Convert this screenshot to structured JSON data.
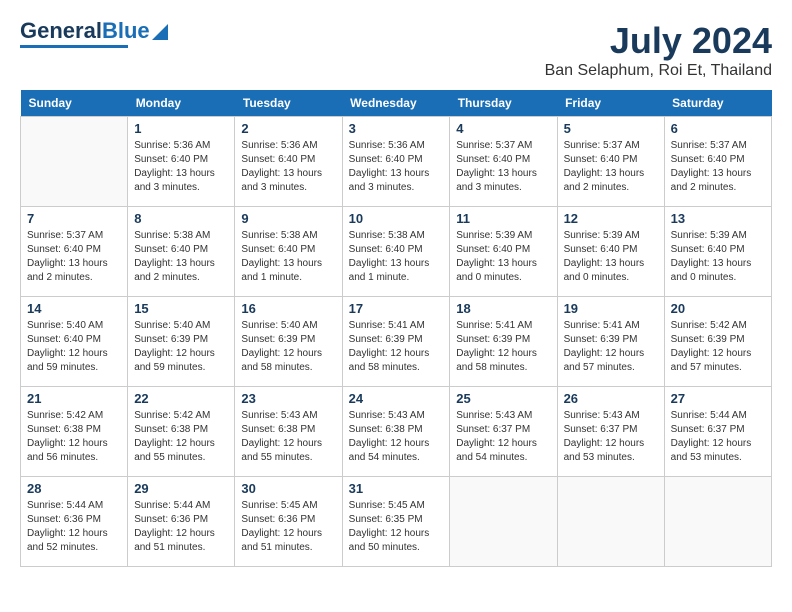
{
  "app": {
    "logo_general": "General",
    "logo_blue": "Blue",
    "month": "July 2024",
    "location": "Ban Selaphum, Roi Et, Thailand"
  },
  "calendar": {
    "headers": [
      "Sunday",
      "Monday",
      "Tuesday",
      "Wednesday",
      "Thursday",
      "Friday",
      "Saturday"
    ],
    "weeks": [
      [
        {
          "day": "",
          "info": ""
        },
        {
          "day": "1",
          "info": "Sunrise: 5:36 AM\nSunset: 6:40 PM\nDaylight: 13 hours\nand 3 minutes."
        },
        {
          "day": "2",
          "info": "Sunrise: 5:36 AM\nSunset: 6:40 PM\nDaylight: 13 hours\nand 3 minutes."
        },
        {
          "day": "3",
          "info": "Sunrise: 5:36 AM\nSunset: 6:40 PM\nDaylight: 13 hours\nand 3 minutes."
        },
        {
          "day": "4",
          "info": "Sunrise: 5:37 AM\nSunset: 6:40 PM\nDaylight: 13 hours\nand 3 minutes."
        },
        {
          "day": "5",
          "info": "Sunrise: 5:37 AM\nSunset: 6:40 PM\nDaylight: 13 hours\nand 2 minutes."
        },
        {
          "day": "6",
          "info": "Sunrise: 5:37 AM\nSunset: 6:40 PM\nDaylight: 13 hours\nand 2 minutes."
        }
      ],
      [
        {
          "day": "7",
          "info": "Sunrise: 5:37 AM\nSunset: 6:40 PM\nDaylight: 13 hours\nand 2 minutes."
        },
        {
          "day": "8",
          "info": "Sunrise: 5:38 AM\nSunset: 6:40 PM\nDaylight: 13 hours\nand 2 minutes."
        },
        {
          "day": "9",
          "info": "Sunrise: 5:38 AM\nSunset: 6:40 PM\nDaylight: 13 hours\nand 1 minute."
        },
        {
          "day": "10",
          "info": "Sunrise: 5:38 AM\nSunset: 6:40 PM\nDaylight: 13 hours\nand 1 minute."
        },
        {
          "day": "11",
          "info": "Sunrise: 5:39 AM\nSunset: 6:40 PM\nDaylight: 13 hours\nand 0 minutes."
        },
        {
          "day": "12",
          "info": "Sunrise: 5:39 AM\nSunset: 6:40 PM\nDaylight: 13 hours\nand 0 minutes."
        },
        {
          "day": "13",
          "info": "Sunrise: 5:39 AM\nSunset: 6:40 PM\nDaylight: 13 hours\nand 0 minutes."
        }
      ],
      [
        {
          "day": "14",
          "info": "Sunrise: 5:40 AM\nSunset: 6:40 PM\nDaylight: 12 hours\nand 59 minutes."
        },
        {
          "day": "15",
          "info": "Sunrise: 5:40 AM\nSunset: 6:39 PM\nDaylight: 12 hours\nand 59 minutes."
        },
        {
          "day": "16",
          "info": "Sunrise: 5:40 AM\nSunset: 6:39 PM\nDaylight: 12 hours\nand 58 minutes."
        },
        {
          "day": "17",
          "info": "Sunrise: 5:41 AM\nSunset: 6:39 PM\nDaylight: 12 hours\nand 58 minutes."
        },
        {
          "day": "18",
          "info": "Sunrise: 5:41 AM\nSunset: 6:39 PM\nDaylight: 12 hours\nand 58 minutes."
        },
        {
          "day": "19",
          "info": "Sunrise: 5:41 AM\nSunset: 6:39 PM\nDaylight: 12 hours\nand 57 minutes."
        },
        {
          "day": "20",
          "info": "Sunrise: 5:42 AM\nSunset: 6:39 PM\nDaylight: 12 hours\nand 57 minutes."
        }
      ],
      [
        {
          "day": "21",
          "info": "Sunrise: 5:42 AM\nSunset: 6:38 PM\nDaylight: 12 hours\nand 56 minutes."
        },
        {
          "day": "22",
          "info": "Sunrise: 5:42 AM\nSunset: 6:38 PM\nDaylight: 12 hours\nand 55 minutes."
        },
        {
          "day": "23",
          "info": "Sunrise: 5:43 AM\nSunset: 6:38 PM\nDaylight: 12 hours\nand 55 minutes."
        },
        {
          "day": "24",
          "info": "Sunrise: 5:43 AM\nSunset: 6:38 PM\nDaylight: 12 hours\nand 54 minutes."
        },
        {
          "day": "25",
          "info": "Sunrise: 5:43 AM\nSunset: 6:37 PM\nDaylight: 12 hours\nand 54 minutes."
        },
        {
          "day": "26",
          "info": "Sunrise: 5:43 AM\nSunset: 6:37 PM\nDaylight: 12 hours\nand 53 minutes."
        },
        {
          "day": "27",
          "info": "Sunrise: 5:44 AM\nSunset: 6:37 PM\nDaylight: 12 hours\nand 53 minutes."
        }
      ],
      [
        {
          "day": "28",
          "info": "Sunrise: 5:44 AM\nSunset: 6:36 PM\nDaylight: 12 hours\nand 52 minutes."
        },
        {
          "day": "29",
          "info": "Sunrise: 5:44 AM\nSunset: 6:36 PM\nDaylight: 12 hours\nand 51 minutes."
        },
        {
          "day": "30",
          "info": "Sunrise: 5:45 AM\nSunset: 6:36 PM\nDaylight: 12 hours\nand 51 minutes."
        },
        {
          "day": "31",
          "info": "Sunrise: 5:45 AM\nSunset: 6:35 PM\nDaylight: 12 hours\nand 50 minutes."
        },
        {
          "day": "",
          "info": ""
        },
        {
          "day": "",
          "info": ""
        },
        {
          "day": "",
          "info": ""
        }
      ]
    ]
  }
}
